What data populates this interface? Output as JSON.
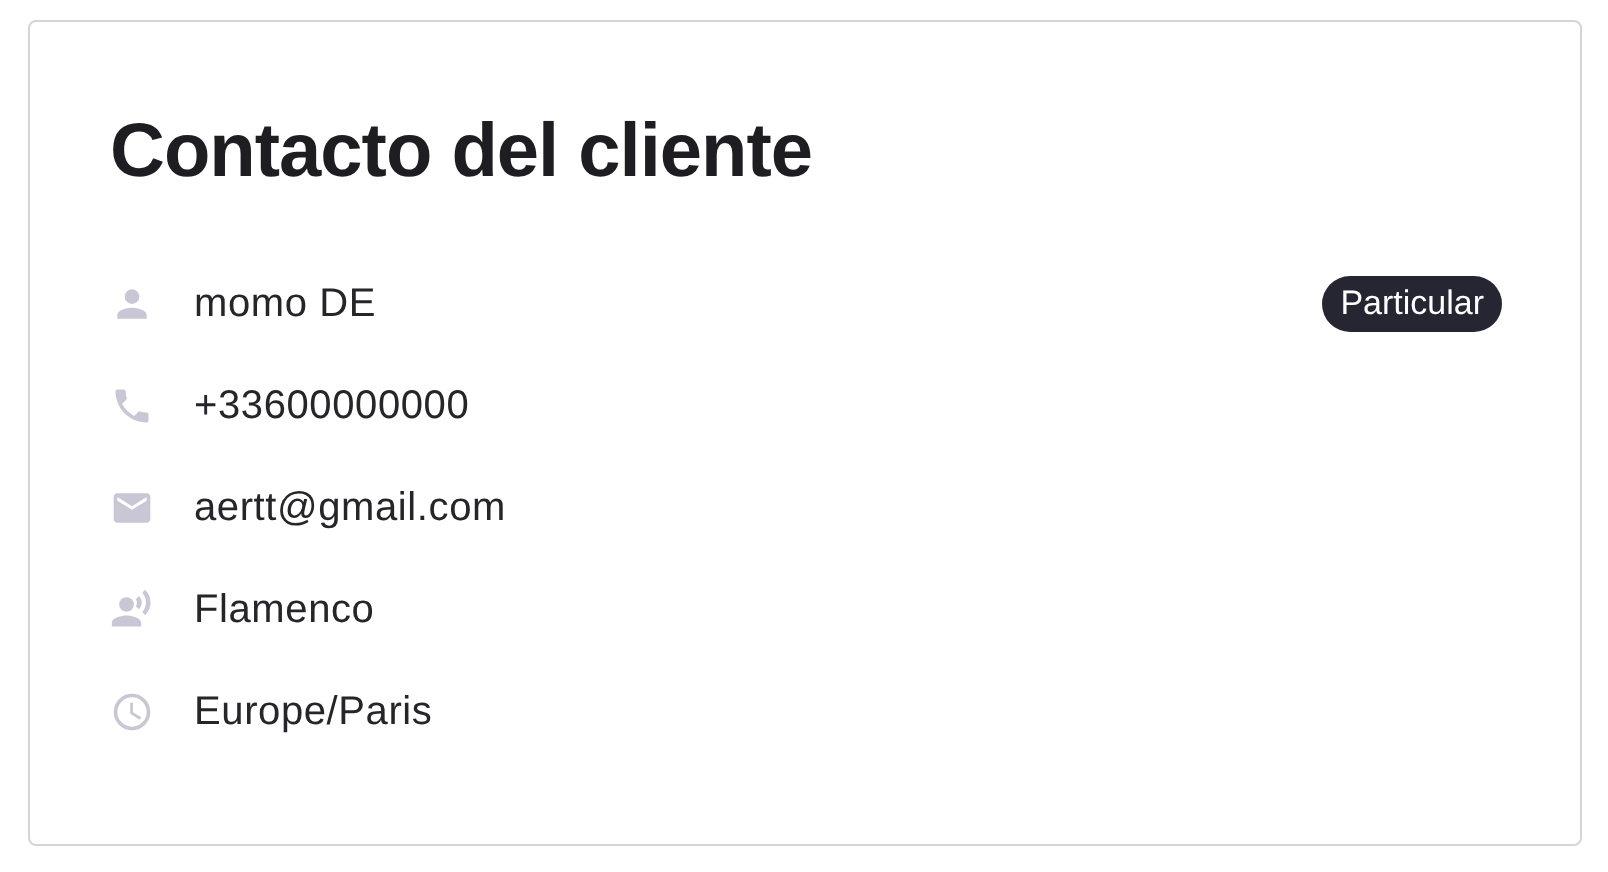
{
  "card": {
    "title": "Contacto del cliente",
    "rows": [
      {
        "kind": "name",
        "value": "momo DE",
        "badge": "Particular"
      },
      {
        "kind": "phone",
        "value": "+33600000000"
      },
      {
        "kind": "email",
        "value": "aertt@gmail.com"
      },
      {
        "kind": "language",
        "value": "Flamenco"
      },
      {
        "kind": "timezone",
        "value": "Europe/Paris"
      }
    ]
  }
}
